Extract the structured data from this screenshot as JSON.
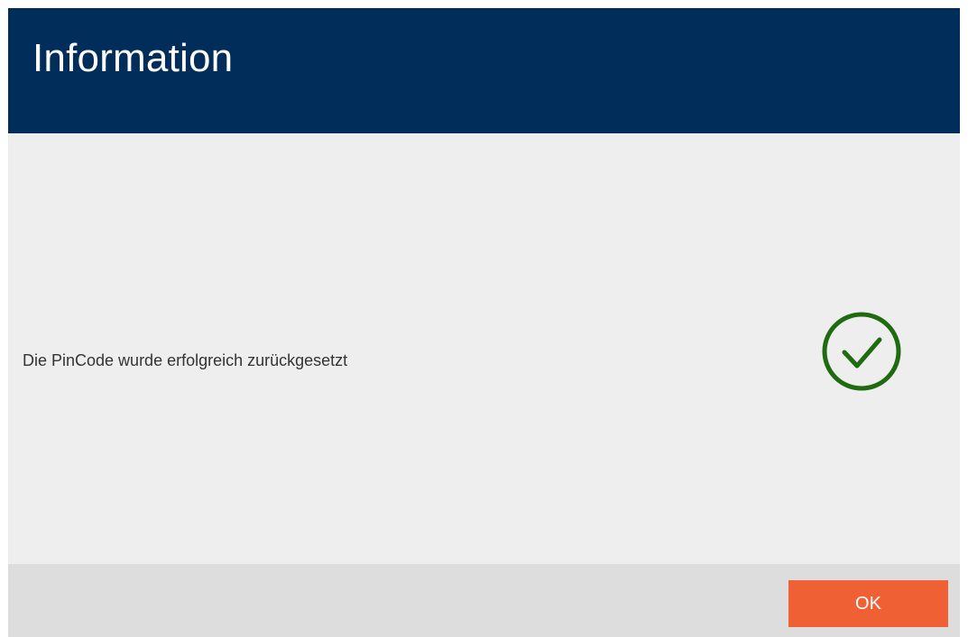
{
  "dialog": {
    "title": "Information",
    "message": "Die PinCode wurde erfolgreich zurückgesetzt",
    "status_icon": "success-checkmark-icon",
    "ok_label": "OK"
  },
  "colors": {
    "header_background": "#002d5a",
    "content_background": "#eeeeee",
    "footer_background": "#dddddd",
    "ok_button": "#ef6135",
    "success_icon": "#1f6b0f"
  }
}
